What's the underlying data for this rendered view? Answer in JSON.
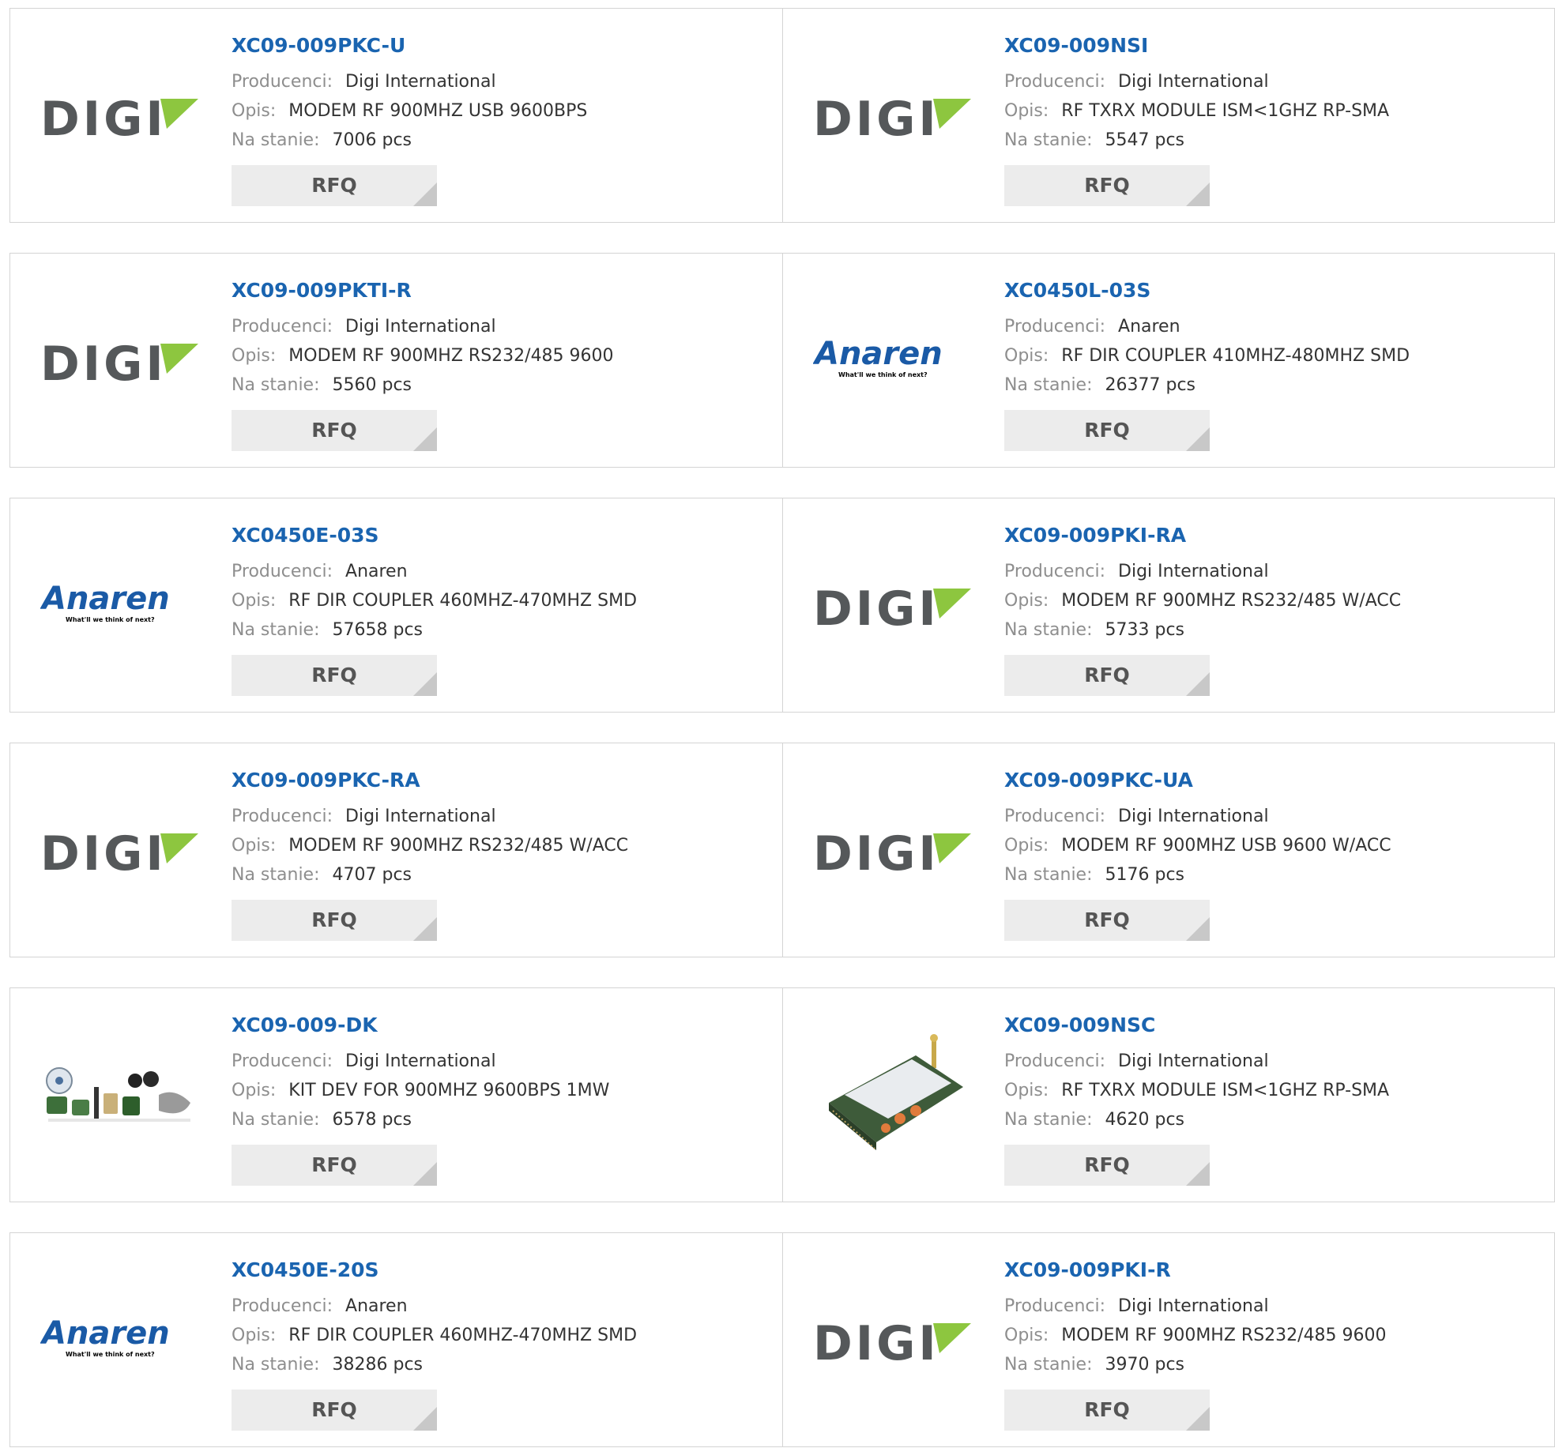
{
  "labels": {
    "manufacturer": "Producenci:",
    "description": "Opis:",
    "stock": "Na stanie:",
    "rfq": "RFQ"
  },
  "colors": {
    "part_link": "#1a64b0",
    "label": "#8e8e8e",
    "value": "#333333",
    "button_bg": "#ececec",
    "digi_green": "#8dc63f",
    "anaren_blue": "#1a5aa6"
  },
  "brand_logos": {
    "digi": {
      "icon": "digi-logo",
      "text": "DIGI"
    },
    "anaren": {
      "icon": "anaren-logo",
      "text": "Anaren",
      "tagline": "What'll we think of next?"
    }
  },
  "products": [
    {
      "part": "XC09-009PKC-U",
      "manufacturer": "Digi International",
      "description": "MODEM RF 900MHZ USB 9600BPS",
      "stock": "7006 pcs",
      "logo": "digi"
    },
    {
      "part": "XC09-009NSI",
      "manufacturer": "Digi International",
      "description": "RF TXRX MODULE ISM<1GHZ RP-SMA",
      "stock": "5547 pcs",
      "logo": "digi"
    },
    {
      "part": "XC09-009PKTI-R",
      "manufacturer": "Digi International",
      "description": "MODEM RF 900MHZ RS232/485 9600",
      "stock": "5560 pcs",
      "logo": "digi"
    },
    {
      "part": "XC0450L-03S",
      "manufacturer": "Anaren",
      "description": "RF DIR COUPLER 410MHZ-480MHZ SMD",
      "stock": "26377 pcs",
      "logo": "anaren"
    },
    {
      "part": "XC0450E-03S",
      "manufacturer": "Anaren",
      "description": "RF DIR COUPLER 460MHZ-470MHZ SMD",
      "stock": "57658 pcs",
      "logo": "anaren"
    },
    {
      "part": "XC09-009PKI-RA",
      "manufacturer": "Digi International",
      "description": "MODEM RF 900MHZ RS232/485 W/ACC",
      "stock": "5733 pcs",
      "logo": "digi"
    },
    {
      "part": "XC09-009PKC-RA",
      "manufacturer": "Digi International",
      "description": "MODEM RF 900MHZ RS232/485 W/ACC",
      "stock": "4707 pcs",
      "logo": "digi"
    },
    {
      "part": "XC09-009PKC-UA",
      "manufacturer": "Digi International",
      "description": "MODEM RF 900MHZ USB 9600 W/ACC",
      "stock": "5176 pcs",
      "logo": "digi"
    },
    {
      "part": "XC09-009-DK",
      "manufacturer": "Digi International",
      "description": "KIT DEV FOR 900MHZ 9600BPS 1MW",
      "stock": "6578 pcs",
      "logo": "kit-photo"
    },
    {
      "part": "XC09-009NSC",
      "manufacturer": "Digi International",
      "description": "RF TXRX MODULE ISM<1GHZ RP-SMA",
      "stock": "4620 pcs",
      "logo": "module-photo"
    },
    {
      "part": "XC0450E-20S",
      "manufacturer": "Anaren",
      "description": "RF DIR COUPLER 460MHZ-470MHZ SMD",
      "stock": "38286 pcs",
      "logo": "anaren"
    },
    {
      "part": "XC09-009PKI-R",
      "manufacturer": "Digi International",
      "description": "MODEM RF 900MHZ RS232/485 9600",
      "stock": "3970 pcs",
      "logo": "digi"
    }
  ]
}
